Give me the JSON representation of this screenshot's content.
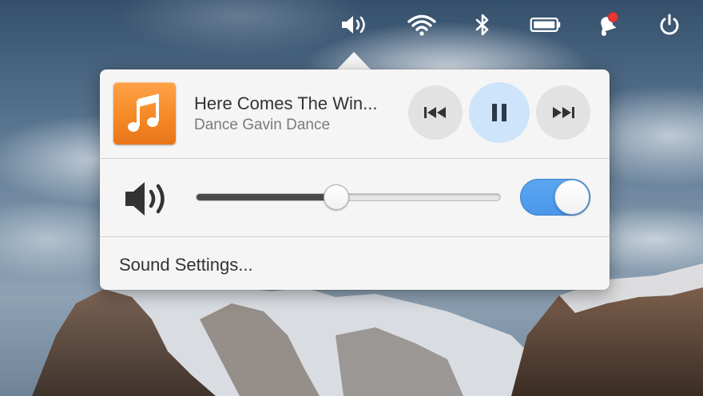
{
  "panel": {
    "indicators": [
      "sound-indicator",
      "network-indicator",
      "bluetooth-indicator",
      "battery-indicator",
      "notifications-indicator",
      "power-indicator"
    ]
  },
  "now_playing": {
    "title": "Here Comes The Win...",
    "artist": "Dance Gavin Dance",
    "state": "playing",
    "album_art_icon": "music-note-icon"
  },
  "controls": {
    "previous_icon": "skip-back-icon",
    "pause_icon": "pause-icon",
    "next_icon": "skip-forward-icon"
  },
  "volume": {
    "level": 0.46,
    "enabled": true
  },
  "menu": {
    "settings_label": "Sound Settings..."
  },
  "colors": {
    "accent": "#4a97ea",
    "album_art": "#f58a26",
    "pause_button": "#cde4fa",
    "notification_badge": "#e53935"
  }
}
